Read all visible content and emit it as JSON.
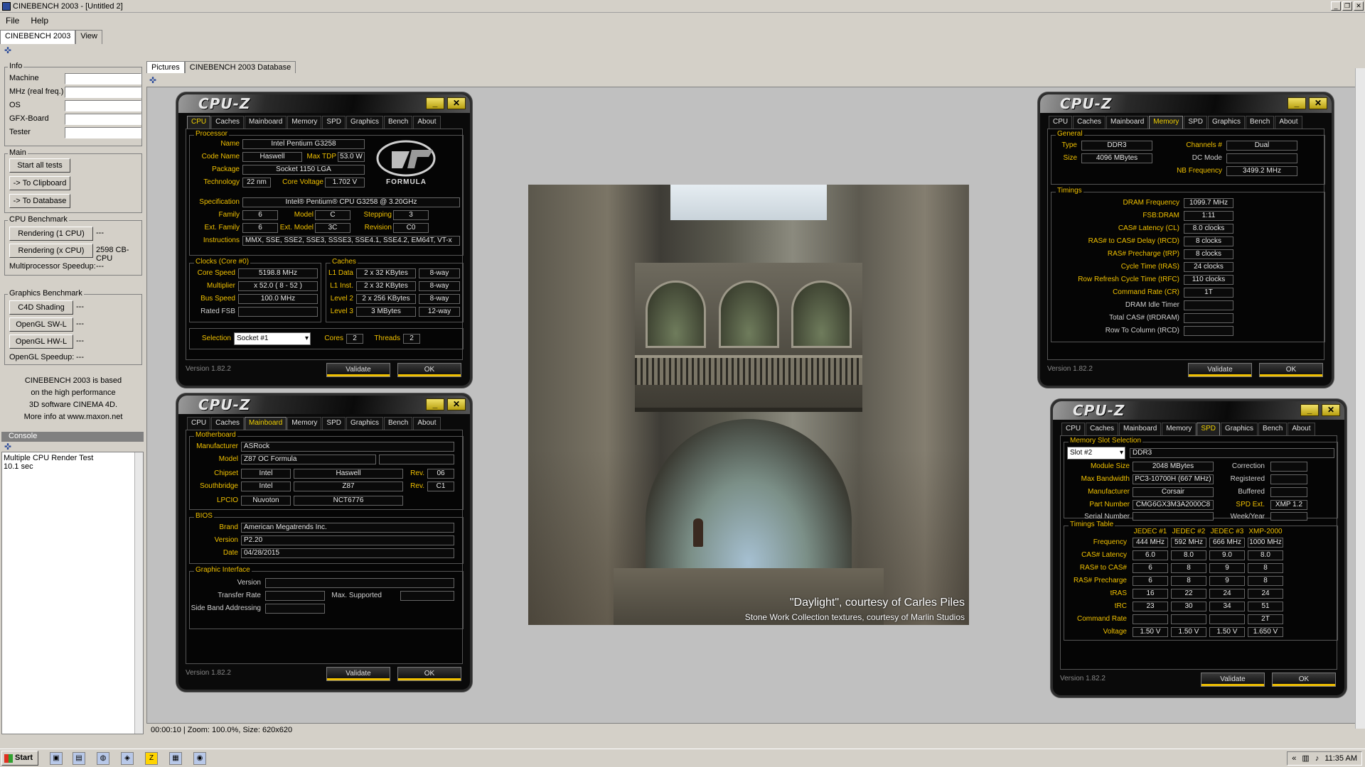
{
  "window": {
    "title": "CINEBENCH 2003 - [Untitled 2]",
    "min": "_",
    "restore": "❐",
    "close": "✕"
  },
  "menu": [
    "File",
    "Help"
  ],
  "app_tabs": [
    "CINEBENCH 2003",
    "View"
  ],
  "left": {
    "info_title": "Info",
    "info_fields": [
      "Machine",
      "MHz (real freq.)",
      "OS",
      "GFX-Board",
      "Tester"
    ],
    "main_title": "Main",
    "main_buttons": [
      "Start all tests",
      "-> To Clipboard",
      "-> To Database"
    ],
    "cpu_title": "CPU Benchmark",
    "cpu_r1": "Rendering (1 CPU)",
    "cpu_r1_val": "---",
    "cpu_rx": "Rendering (x CPU)",
    "cpu_rx_val": "2598 CB-CPU",
    "mp_speedup": "Multiprocessor Speedup:",
    "mp_speedup_val": "---",
    "gfx_title": "Graphics Benchmark",
    "gfx_b1": "C4D Shading",
    "gfx_b1_val": "---",
    "gfx_b2": "OpenGL SW-L",
    "gfx_b2_val": "---",
    "gfx_b3": "OpenGL HW-L",
    "gfx_b3_val": "---",
    "gl_speedup": "OpenGL Speedup:",
    "gl_speedup_val": "---",
    "about": [
      "CINEBENCH 2003 is based",
      "on the high performance",
      "3D software CINEMA 4D.",
      "More info at www.maxon.net"
    ],
    "console_title": "Console",
    "console_lines": [
      "Multiple CPU Render Test",
      "10.1 sec"
    ]
  },
  "main": {
    "tabs": [
      "Pictures",
      "CINEBENCH 2003 Database"
    ],
    "status": "00:00:10 | Zoom: 100.0%, Size: 620x620",
    "caption1": "\"Daylight\", courtesy of Carles Piles",
    "caption2": "Stone Work Collection textures, courtesy of Marlin Studios"
  },
  "cpuz_common": {
    "logo": "CPU-Z",
    "tabs": [
      "CPU",
      "Caches",
      "Mainboard",
      "Memory",
      "SPD",
      "Graphics",
      "Bench",
      "About"
    ],
    "version": "Version 1.82.2",
    "validate": "Validate",
    "ok": "OK",
    "min": "_",
    "close": "✕"
  },
  "cpu": {
    "processor_title": "Processor",
    "name_l": "Name",
    "name": "Intel Pentium G3258",
    "code_l": "Code Name",
    "code": "Haswell",
    "tdp_l": "Max TDP",
    "tdp": "53.0 W",
    "pkg_l": "Package",
    "pkg": "Socket 1150 LGA",
    "tech_l": "Technology",
    "tech": "22 nm",
    "cv_l": "Core Voltage",
    "cv": "1.702 V",
    "spec_l": "Specification",
    "spec": "Intel® Pentium® CPU G3258 @ 3.20GHz",
    "fam_l": "Family",
    "fam": "6",
    "model_l": "Model",
    "model": "C",
    "step_l": "Stepping",
    "step": "3",
    "efam_l": "Ext. Family",
    "efam": "6",
    "emodel_l": "Ext. Model",
    "emodel": "3C",
    "rev_l": "Revision",
    "rev": "C0",
    "instr_l": "Instructions",
    "instr": "MMX, SSE, SSE2, SSE3, SSSE3, SSE4.1, SSE4.2, EM64T, VT-x",
    "logo_text": "FORMULA",
    "clocks_title": "Clocks (Core #0)",
    "cs_l": "Core Speed",
    "cs": "5198.8 MHz",
    "mul_l": "Multiplier",
    "mul": "x 52.0 ( 8 - 52 )",
    "bus_l": "Bus Speed",
    "bus": "100.0 MHz",
    "fsb_l": "Rated FSB",
    "fsb": "",
    "caches_title": "Caches",
    "l1d_l": "L1 Data",
    "l1d": "2 x 32 KBytes",
    "l1d_w": "8-way",
    "l1i_l": "L1 Inst.",
    "l1i": "2 x 32 KBytes",
    "l1i_w": "8-way",
    "l2_l": "Level 2",
    "l2": "2 x 256 KBytes",
    "l2_w": "8-way",
    "l3_l": "Level 3",
    "l3": "3 MBytes",
    "l3_w": "12-way",
    "sel_l": "Selection",
    "sel": "Socket #1",
    "cores_l": "Cores",
    "cores": "2",
    "threads_l": "Threads",
    "threads": "2"
  },
  "mainboard": {
    "mb_title": "Motherboard",
    "man_l": "Manufacturer",
    "man": "ASRock",
    "model_l": "Model",
    "model": "Z87 OC Formula",
    "chip_l": "Chipset",
    "chip_v": "Intel",
    "chip_n": "Haswell",
    "chip_rev_l": "Rev.",
    "chip_rev": "06",
    "sb_l": "Southbridge",
    "sb_v": "Intel",
    "sb_n": "Z87",
    "sb_rev_l": "Rev.",
    "sb_rev": "C1",
    "lpc_l": "LPCIO",
    "lpc_v": "Nuvoton",
    "lpc_n": "NCT6776",
    "bios_title": "BIOS",
    "brand_l": "Brand",
    "brand": "American Megatrends Inc.",
    "ver_l": "Version",
    "ver": "P2.20",
    "date_l": "Date",
    "date": "04/28/2015",
    "gi_title": "Graphic Interface",
    "giv_l": "Version",
    "tr_l": "Transfer Rate",
    "ms_l": "Max. Supported",
    "sba_l": "Side Band Addressing"
  },
  "memory": {
    "gen_title": "General",
    "type_l": "Type",
    "type": "DDR3",
    "ch_l": "Channels #",
    "ch": "Dual",
    "size_l": "Size",
    "size": "4096 MBytes",
    "dc_l": "DC Mode",
    "dc": "",
    "nb_l": "NB Frequency",
    "nb": "3499.2 MHz",
    "tim_title": "Timings",
    "rows": [
      {
        "l": "DRAM Frequency",
        "v": "1099.7 MHz",
        "c": "y"
      },
      {
        "l": "FSB:DRAM",
        "v": "1:11",
        "c": "y"
      },
      {
        "l": "CAS# Latency (CL)",
        "v": "8.0 clocks",
        "c": "y"
      },
      {
        "l": "RAS# to CAS# Delay (tRCD)",
        "v": "8 clocks",
        "c": "y"
      },
      {
        "l": "RAS# Precharge (tRP)",
        "v": "8 clocks",
        "c": "y"
      },
      {
        "l": "Cycle Time (tRAS)",
        "v": "24 clocks",
        "c": "y"
      },
      {
        "l": "Row Refresh Cycle Time (tRFC)",
        "v": "110 clocks",
        "c": "y"
      },
      {
        "l": "Command Rate (CR)",
        "v": "1T",
        "c": "y"
      },
      {
        "l": "DRAM Idle Timer",
        "v": "",
        "c": "w"
      },
      {
        "l": "Total CAS# (tRDRAM)",
        "v": "",
        "c": "w"
      },
      {
        "l": "Row To Column (tRCD)",
        "v": "",
        "c": "w"
      }
    ]
  },
  "spd": {
    "slot_title": "Memory Slot Selection",
    "slot": "Slot #2",
    "mtype": "DDR3",
    "msize_l": "Module Size",
    "msize": "2048 MBytes",
    "corr_l": "Correction",
    "bw_l": "Max Bandwidth",
    "bw": "PC3-10700H (667 MHz)",
    "reg_l": "Registered",
    "man_l": "Manufacturer",
    "man": "Corsair",
    "buf_l": "Buffered",
    "part_l": "Part Number",
    "part": "CMG6GX3M3A2000C8",
    "ext_l": "SPD Ext.",
    "ext": "XMP 1.2",
    "ser_l": "Serial Number",
    "wy_l": "Week/Year",
    "tt_title": "Timings Table",
    "cols": [
      "JEDEC #1",
      "JEDEC #2",
      "JEDEC #3",
      "XMP-2000"
    ],
    "trows": [
      {
        "l": "Frequency",
        "v": [
          "444 MHz",
          "592 MHz",
          "666 MHz",
          "1000 MHz"
        ]
      },
      {
        "l": "CAS# Latency",
        "v": [
          "6.0",
          "8.0",
          "9.0",
          "8.0"
        ]
      },
      {
        "l": "RAS# to CAS#",
        "v": [
          "6",
          "8",
          "9",
          "8"
        ]
      },
      {
        "l": "RAS# Precharge",
        "v": [
          "6",
          "8",
          "9",
          "8"
        ]
      },
      {
        "l": "tRAS",
        "v": [
          "16",
          "22",
          "24",
          "24"
        ]
      },
      {
        "l": "tRC",
        "v": [
          "23",
          "30",
          "34",
          "51"
        ]
      },
      {
        "l": "Command Rate",
        "v": [
          "",
          "",
          "",
          "2T"
        ]
      },
      {
        "l": "Voltage",
        "v": [
          "1.50 V",
          "1.50 V",
          "1.50 V",
          "1.650 V"
        ]
      }
    ]
  },
  "taskbar": {
    "start": "Start",
    "clock": "11:35 AM",
    "tray_chevron": "«"
  }
}
